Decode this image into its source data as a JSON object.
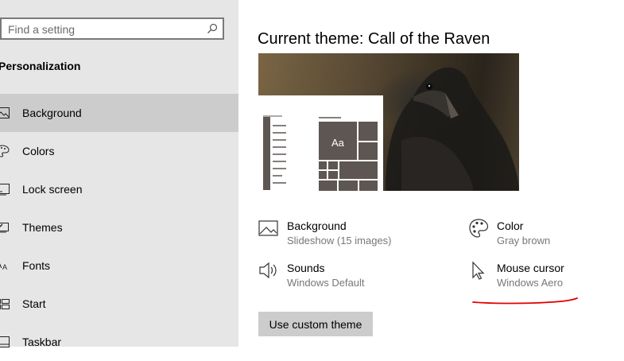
{
  "search": {
    "placeholder": "Find a setting"
  },
  "sidebar": {
    "section_title": "Personalization",
    "items": [
      {
        "label": "Background",
        "icon": "image-icon",
        "selected": true
      },
      {
        "label": "Colors",
        "icon": "palette-icon",
        "selected": false
      },
      {
        "label": "Lock screen",
        "icon": "lock-screen-icon",
        "selected": false
      },
      {
        "label": "Themes",
        "icon": "themes-icon",
        "selected": false
      },
      {
        "label": "Fonts",
        "icon": "fonts-icon",
        "selected": false
      },
      {
        "label": "Start",
        "icon": "start-icon",
        "selected": false
      },
      {
        "label": "Taskbar",
        "icon": "taskbar-icon",
        "selected": false
      }
    ]
  },
  "main": {
    "title": "Current theme: Call of the Raven",
    "preview": {
      "tile_label": "Aa"
    },
    "settings": [
      {
        "name": "Background",
        "value": "Slideshow (15 images)",
        "icon": "image-icon"
      },
      {
        "name": "Color",
        "value": "Gray brown",
        "icon": "palette-icon"
      },
      {
        "name": "Sounds",
        "value": "Windows Default",
        "icon": "speaker-icon"
      },
      {
        "name": "Mouse cursor",
        "value": "Windows Aero",
        "icon": "cursor-icon"
      }
    ],
    "custom_theme_button": "Use custom theme"
  },
  "colors": {
    "sidebar_bg": "#e6e6e6",
    "selected_bg": "#cccccc",
    "tile_color": "#5d5652",
    "annotation": "#e00000"
  }
}
